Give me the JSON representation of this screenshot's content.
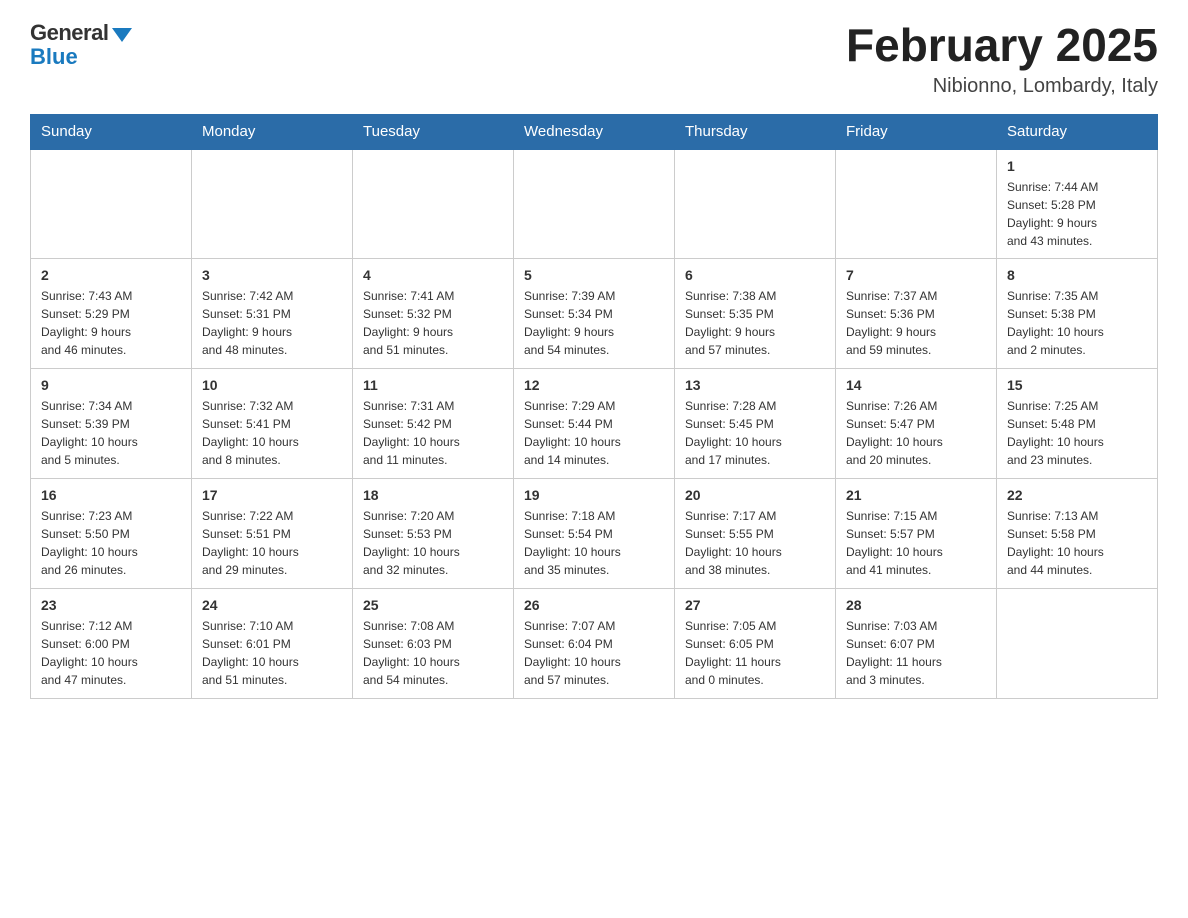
{
  "header": {
    "logo_general": "General",
    "logo_blue": "Blue",
    "month_title": "February 2025",
    "location": "Nibionno, Lombardy, Italy"
  },
  "days_of_week": [
    "Sunday",
    "Monday",
    "Tuesday",
    "Wednesday",
    "Thursday",
    "Friday",
    "Saturday"
  ],
  "weeks": [
    [
      {
        "day": "",
        "info": ""
      },
      {
        "day": "",
        "info": ""
      },
      {
        "day": "",
        "info": ""
      },
      {
        "day": "",
        "info": ""
      },
      {
        "day": "",
        "info": ""
      },
      {
        "day": "",
        "info": ""
      },
      {
        "day": "1",
        "info": "Sunrise: 7:44 AM\nSunset: 5:28 PM\nDaylight: 9 hours\nand 43 minutes."
      }
    ],
    [
      {
        "day": "2",
        "info": "Sunrise: 7:43 AM\nSunset: 5:29 PM\nDaylight: 9 hours\nand 46 minutes."
      },
      {
        "day": "3",
        "info": "Sunrise: 7:42 AM\nSunset: 5:31 PM\nDaylight: 9 hours\nand 48 minutes."
      },
      {
        "day": "4",
        "info": "Sunrise: 7:41 AM\nSunset: 5:32 PM\nDaylight: 9 hours\nand 51 minutes."
      },
      {
        "day": "5",
        "info": "Sunrise: 7:39 AM\nSunset: 5:34 PM\nDaylight: 9 hours\nand 54 minutes."
      },
      {
        "day": "6",
        "info": "Sunrise: 7:38 AM\nSunset: 5:35 PM\nDaylight: 9 hours\nand 57 minutes."
      },
      {
        "day": "7",
        "info": "Sunrise: 7:37 AM\nSunset: 5:36 PM\nDaylight: 9 hours\nand 59 minutes."
      },
      {
        "day": "8",
        "info": "Sunrise: 7:35 AM\nSunset: 5:38 PM\nDaylight: 10 hours\nand 2 minutes."
      }
    ],
    [
      {
        "day": "9",
        "info": "Sunrise: 7:34 AM\nSunset: 5:39 PM\nDaylight: 10 hours\nand 5 minutes."
      },
      {
        "day": "10",
        "info": "Sunrise: 7:32 AM\nSunset: 5:41 PM\nDaylight: 10 hours\nand 8 minutes."
      },
      {
        "day": "11",
        "info": "Sunrise: 7:31 AM\nSunset: 5:42 PM\nDaylight: 10 hours\nand 11 minutes."
      },
      {
        "day": "12",
        "info": "Sunrise: 7:29 AM\nSunset: 5:44 PM\nDaylight: 10 hours\nand 14 minutes."
      },
      {
        "day": "13",
        "info": "Sunrise: 7:28 AM\nSunset: 5:45 PM\nDaylight: 10 hours\nand 17 minutes."
      },
      {
        "day": "14",
        "info": "Sunrise: 7:26 AM\nSunset: 5:47 PM\nDaylight: 10 hours\nand 20 minutes."
      },
      {
        "day": "15",
        "info": "Sunrise: 7:25 AM\nSunset: 5:48 PM\nDaylight: 10 hours\nand 23 minutes."
      }
    ],
    [
      {
        "day": "16",
        "info": "Sunrise: 7:23 AM\nSunset: 5:50 PM\nDaylight: 10 hours\nand 26 minutes."
      },
      {
        "day": "17",
        "info": "Sunrise: 7:22 AM\nSunset: 5:51 PM\nDaylight: 10 hours\nand 29 minutes."
      },
      {
        "day": "18",
        "info": "Sunrise: 7:20 AM\nSunset: 5:53 PM\nDaylight: 10 hours\nand 32 minutes."
      },
      {
        "day": "19",
        "info": "Sunrise: 7:18 AM\nSunset: 5:54 PM\nDaylight: 10 hours\nand 35 minutes."
      },
      {
        "day": "20",
        "info": "Sunrise: 7:17 AM\nSunset: 5:55 PM\nDaylight: 10 hours\nand 38 minutes."
      },
      {
        "day": "21",
        "info": "Sunrise: 7:15 AM\nSunset: 5:57 PM\nDaylight: 10 hours\nand 41 minutes."
      },
      {
        "day": "22",
        "info": "Sunrise: 7:13 AM\nSunset: 5:58 PM\nDaylight: 10 hours\nand 44 minutes."
      }
    ],
    [
      {
        "day": "23",
        "info": "Sunrise: 7:12 AM\nSunset: 6:00 PM\nDaylight: 10 hours\nand 47 minutes."
      },
      {
        "day": "24",
        "info": "Sunrise: 7:10 AM\nSunset: 6:01 PM\nDaylight: 10 hours\nand 51 minutes."
      },
      {
        "day": "25",
        "info": "Sunrise: 7:08 AM\nSunset: 6:03 PM\nDaylight: 10 hours\nand 54 minutes."
      },
      {
        "day": "26",
        "info": "Sunrise: 7:07 AM\nSunset: 6:04 PM\nDaylight: 10 hours\nand 57 minutes."
      },
      {
        "day": "27",
        "info": "Sunrise: 7:05 AM\nSunset: 6:05 PM\nDaylight: 11 hours\nand 0 minutes."
      },
      {
        "day": "28",
        "info": "Sunrise: 7:03 AM\nSunset: 6:07 PM\nDaylight: 11 hours\nand 3 minutes."
      },
      {
        "day": "",
        "info": ""
      }
    ]
  ]
}
